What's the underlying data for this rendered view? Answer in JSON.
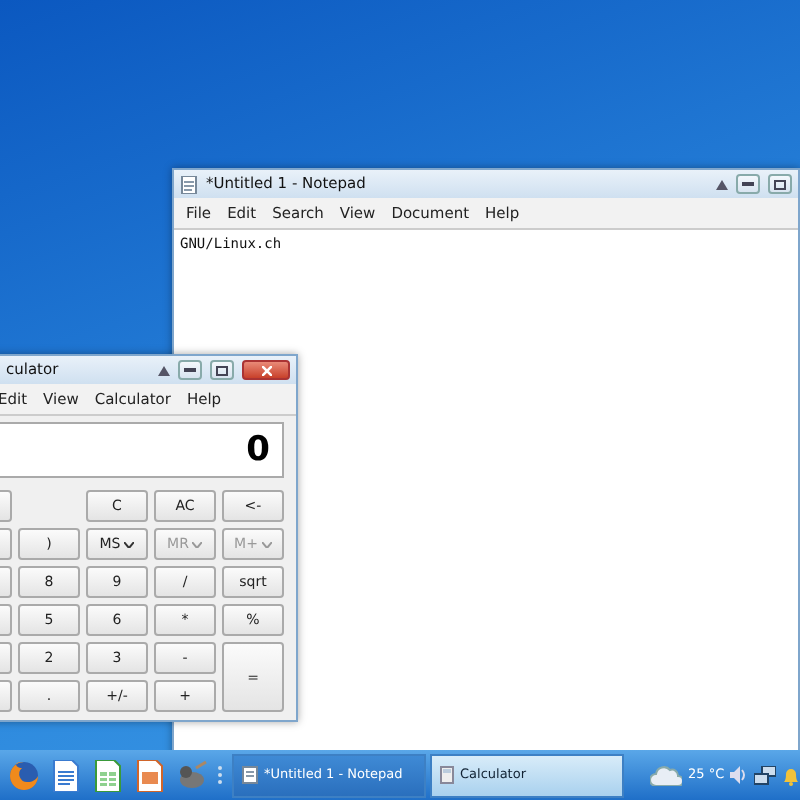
{
  "notepad": {
    "title": "*Untitled 1 - Notepad",
    "menu": [
      "File",
      "Edit",
      "Search",
      "View",
      "Document",
      "Help"
    ],
    "text": "GNU/Linux.ch"
  },
  "calculator": {
    "title": "culator",
    "menu": [
      "Edit",
      "View",
      "Calculator",
      "Help"
    ],
    "display": "0",
    "keys": [
      [
        {
          "label": "C",
          "kind": "plain",
          "disabled": false
        },
        {
          "label": "AC",
          "kind": "plain",
          "disabled": false
        },
        {
          "label": "<-",
          "kind": "plain",
          "disabled": false
        }
      ],
      [
        {
          "label": ")",
          "kind": "plain",
          "disabled": false
        },
        {
          "label": "MS",
          "kind": "dropdown",
          "disabled": false
        },
        {
          "label": "MR",
          "kind": "dropdown",
          "disabled": true
        },
        {
          "label": "M+",
          "kind": "dropdown",
          "disabled": true
        }
      ],
      [
        {
          "label": "8",
          "kind": "plain",
          "disabled": false
        },
        {
          "label": "9",
          "kind": "plain",
          "disabled": false
        },
        {
          "label": "/",
          "kind": "plain",
          "disabled": false
        },
        {
          "label": "sqrt",
          "kind": "plain",
          "disabled": false
        }
      ],
      [
        {
          "label": "5",
          "kind": "plain",
          "disabled": false
        },
        {
          "label": "6",
          "kind": "plain",
          "disabled": false
        },
        {
          "label": "*",
          "kind": "plain",
          "disabled": false
        },
        {
          "label": "%",
          "kind": "plain",
          "disabled": false
        }
      ],
      [
        {
          "label": "2",
          "kind": "plain",
          "disabled": false
        },
        {
          "label": "3",
          "kind": "plain",
          "disabled": false
        },
        {
          "label": "-",
          "kind": "plain",
          "disabled": false
        },
        {
          "label": "=",
          "kind": "tall",
          "disabled": false
        }
      ],
      [
        {
          "label": ".",
          "kind": "plain",
          "disabled": false
        },
        {
          "label": "+/-",
          "kind": "plain",
          "disabled": false
        },
        {
          "label": "+",
          "kind": "plain",
          "disabled": false
        }
      ]
    ]
  },
  "taskbar": {
    "tasks": [
      {
        "label": "*Untitled 1 - Notepad",
        "kind": "notepad",
        "selected": false
      },
      {
        "label": "Calculator",
        "kind": "calculator",
        "selected": true
      }
    ],
    "temperature": "25 °C"
  }
}
